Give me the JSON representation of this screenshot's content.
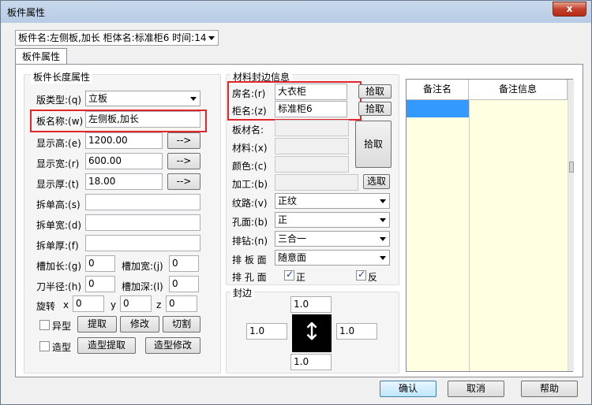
{
  "window": {
    "title": "板件属性",
    "close_glyph": "x"
  },
  "top_combo": {
    "value": "板件名:左侧板,加长 柜体名:标准柜6 时间:14"
  },
  "tab": {
    "label": "板件属性"
  },
  "length_group": {
    "title": "板件长度属性",
    "board_type_label": "版类型:(q)",
    "board_type_value": "立板",
    "board_name_label": "板名称:(w)",
    "board_name_value": "左侧板,加长",
    "disp_height_label": "显示高:(e)",
    "disp_height_value": "1200.00",
    "disp_width_label": "显示宽:(r)",
    "disp_width_value": "600.00",
    "disp_thick_label": "显示厚:(t)",
    "disp_thick_value": "18.00",
    "arrow_label": "-->",
    "split_height_label": "拆单高:(s)",
    "split_width_label": "拆单宽:(d)",
    "split_thick_label": "拆单厚:(f)",
    "groove_len_label": "槽加长:(g)",
    "groove_len_value": "0",
    "groove_wid_label": "槽加宽:(j)",
    "groove_wid_value": "0",
    "knife_label": "刀半径:(h)",
    "knife_value": "0",
    "groove_depth_label": "槽加深:(l)",
    "groove_depth_value": "0",
    "rotate_label": "旋转",
    "rot_x_label": "x",
    "rot_x_value": "0",
    "rot_y_label": "y",
    "rot_y_value": "0",
    "rot_z_label": "z",
    "rot_z_value": "0",
    "irregular_label": "异型",
    "extract_btn": "提取",
    "modify_btn": "修改",
    "cut_btn": "切割",
    "shape_label": "造型",
    "shape_extract_btn": "造型提取",
    "shape_modify_btn": "造型修改"
  },
  "material_group": {
    "title": "材料封边信息",
    "room_label": "房名:(r)",
    "room_value": "大衣柜",
    "cabinet_label": "柜名:(z)",
    "cabinet_value": "标准柜6",
    "pick_btn": "拾取",
    "board_mat_label": "板材名:",
    "material_label": "材料:(x)",
    "color_label": "颜色:(c)",
    "process_label": "加工:(b)",
    "select_btn": "选取",
    "grain_label": "纹路:(v)",
    "grain_value": "正纹",
    "hole_face_label": "孔面:(b)",
    "hole_face_value": "正",
    "drill_label": "排钻:(n)",
    "drill_value": "三合一",
    "row_face_label": "排 板 面",
    "row_face_value": "随意面",
    "row_hole_label": "排 孔 面",
    "front_label": "正",
    "back_label": "反"
  },
  "edge_group": {
    "title": "封边",
    "top": "1.0",
    "left": "1.0",
    "right": "1.0",
    "bottom": "1.0",
    "center_glyph": "↕"
  },
  "notes_grid": {
    "columns": [
      "备注名",
      "备注信息"
    ]
  },
  "footer": {
    "ok": "确认",
    "cancel": "取消",
    "help": "帮助"
  }
}
